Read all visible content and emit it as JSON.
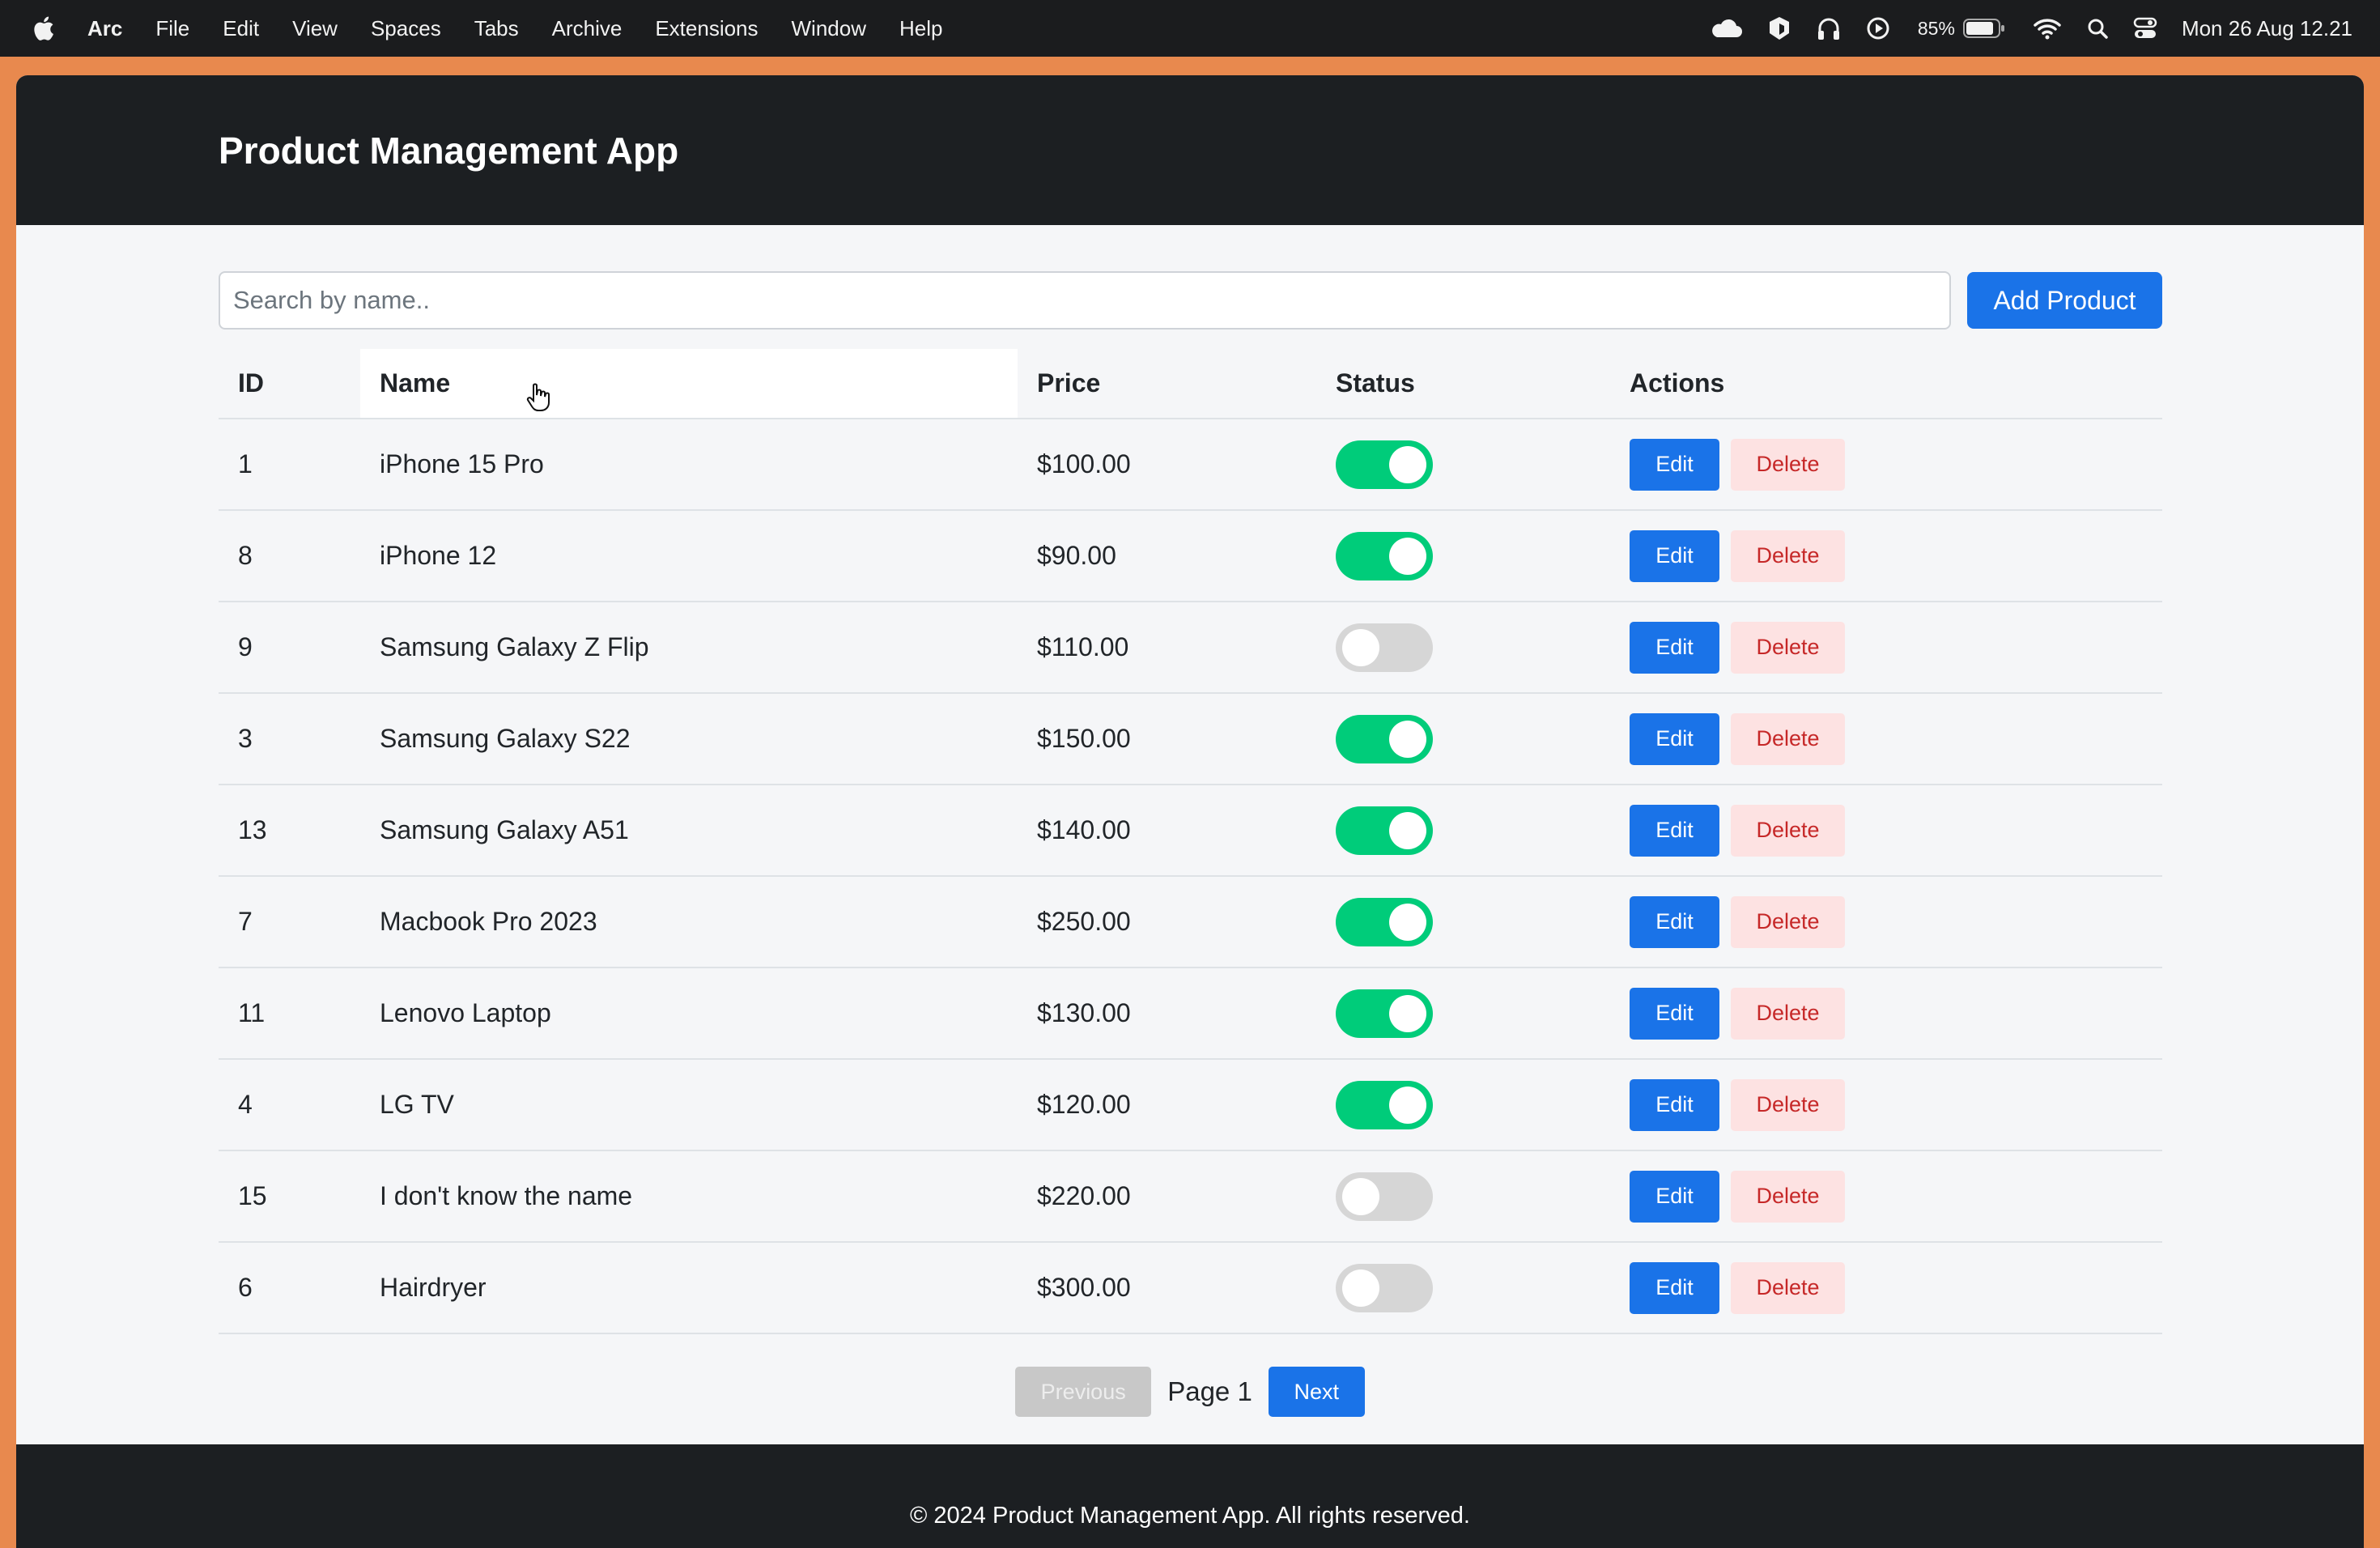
{
  "menubar": {
    "app_name": "Arc",
    "items": [
      "File",
      "Edit",
      "View",
      "Spaces",
      "Tabs",
      "Archive",
      "Extensions",
      "Window",
      "Help"
    ],
    "battery_percent": "85%",
    "clock": "Mon 26 Aug  12.21",
    "status_icons": [
      "cloud-icon",
      "cube-icon",
      "headphones-icon",
      "play-circle-icon",
      "battery-icon",
      "wifi-icon",
      "search-icon",
      "control-center-icon"
    ]
  },
  "app": {
    "title": "Product Management App",
    "search": {
      "placeholder": "Search by name..",
      "value": ""
    },
    "add_label": "Add Product",
    "table": {
      "headers": {
        "id": "ID",
        "name": "Name",
        "price": "Price",
        "status": "Status",
        "actions": "Actions"
      },
      "edit_label": "Edit",
      "delete_label": "Delete",
      "rows": [
        {
          "id": "1",
          "name": "iPhone 15 Pro",
          "price": "$100.00",
          "active": true
        },
        {
          "id": "8",
          "name": "iPhone 12",
          "price": "$90.00",
          "active": true
        },
        {
          "id": "9",
          "name": "Samsung Galaxy Z Flip",
          "price": "$110.00",
          "active": false
        },
        {
          "id": "3",
          "name": "Samsung Galaxy S22",
          "price": "$150.00",
          "active": true
        },
        {
          "id": "13",
          "name": "Samsung Galaxy A51",
          "price": "$140.00",
          "active": true
        },
        {
          "id": "7",
          "name": "Macbook Pro 2023",
          "price": "$250.00",
          "active": true
        },
        {
          "id": "11",
          "name": "Lenovo Laptop",
          "price": "$130.00",
          "active": true
        },
        {
          "id": "4",
          "name": "LG TV",
          "price": "$120.00",
          "active": true
        },
        {
          "id": "15",
          "name": "I don't know the name",
          "price": "$220.00",
          "active": false
        },
        {
          "id": "6",
          "name": "Hairdryer",
          "price": "$300.00",
          "active": false
        }
      ]
    },
    "pagination": {
      "previous_label": "Previous",
      "page_label": "Page 1",
      "next_label": "Next"
    },
    "footer": "© 2024 Product Management App. All rights reserved."
  },
  "colors": {
    "window_border": "#e8894e",
    "header_bg": "#1c1f22",
    "primary": "#1a73e8",
    "toggle_on": "#00cc7a",
    "toggle_off": "#d6d6d6",
    "delete_bg": "#fde2e2",
    "delete_text": "#c62828"
  }
}
